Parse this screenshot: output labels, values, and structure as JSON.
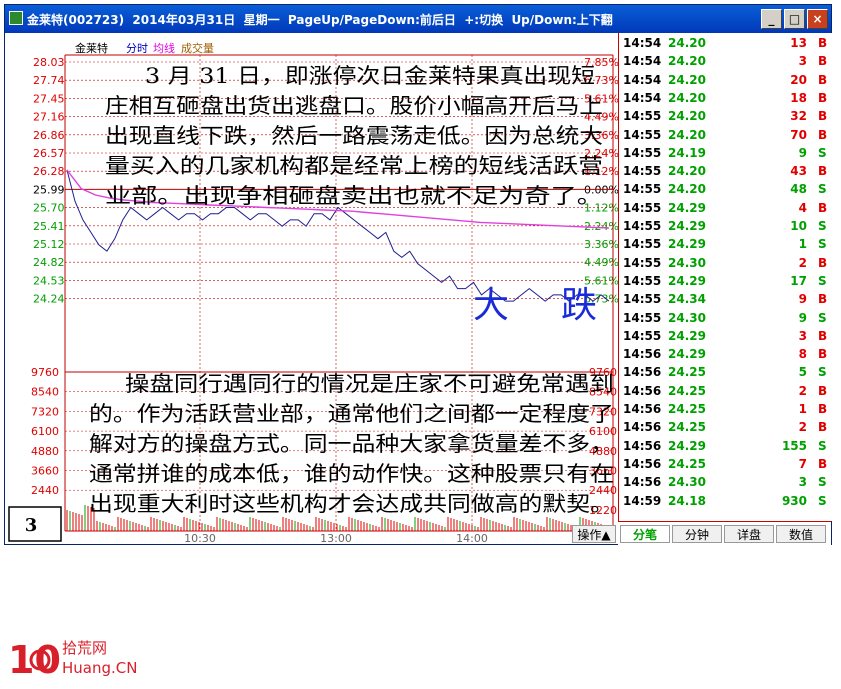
{
  "window": {
    "title": "金莱特(002723)  2014年03月31日  星期一  PageUp/PageDown:前后日  +:切换  Up/Down:上下翻",
    "minimize": "_",
    "maximize": "□",
    "close": "×"
  },
  "chart": {
    "stock_name": "金莱特",
    "tab_intraday": "分时",
    "tab_avg": "均线",
    "tab_volume": "成交量",
    "price_ticks": [
      "28.03",
      "27.74",
      "27.45",
      "27.16",
      "26.86",
      "26.57",
      "26.28",
      "25.99",
      "25.70",
      "25.41",
      "25.12",
      "24.82",
      "24.53",
      "24.24"
    ],
    "pct_ticks": [
      "7.85%",
      "6.73%",
      "5.61%",
      "4.49%",
      "3.36%",
      "2.24%",
      "1.12%",
      "0.00%",
      "1.12%",
      "2.24%",
      "3.36%",
      "4.49%",
      "5.61%",
      "6.73%"
    ],
    "vol_ticks_left": [
      "9760",
      "8540",
      "7320",
      "6100",
      "4880",
      "3660",
      "2440"
    ],
    "vol_ticks_right": [
      "9760",
      "8540",
      "7320",
      "6100",
      "4880",
      "3660",
      "2440",
      "1220"
    ],
    "time_labels": [
      "10:30",
      "13:00",
      "14:00"
    ],
    "page_number": "3",
    "op_button": "操作▲",
    "annotation_top": "3 月 31 日，即涨停次日金莱特果真出现短庄相互砸盘出货出逃盘口。股价小幅高开后马上出现直线下跌，然后一路震荡走低。因为总统大量买入的几家机构都是经常上榜的短线活跃营业部。出现争相砸盘卖出也就不足为奇了。",
    "annotation_top_lines": [
      "3 月 31 日，即涨停次日金莱特果真出现短",
      "庄相互砸盘出货出逃盘口。股价小幅高开后马上",
      "出现直线下跌，然后一路震荡走低。因为总统大",
      "量买入的几家机构都是经常上榜的短线活跃营",
      "业部。出现争相砸盘卖出也就不足为奇了。"
    ],
    "big_label_1": "大",
    "big_label_2": "跌",
    "annotation_bottom_lines": [
      "操盘同行遇同行的情况是庄家不可避免常遇到",
      "的。作为活跃营业部，通常他们之间都一定程度了",
      "解对方的操盘方式。同一品种大家拿货量差不多，",
      "通常拼谁的成本低，谁的动作快。这种股票只有在",
      "出现重大利时这些机构才会达成共同做高的默契。"
    ],
    "colors": {
      "price_line": "#1f1f8f",
      "avg_line": "#e040e0",
      "up": "#e00000",
      "down": "#00a000",
      "grid": "#c00000"
    }
  },
  "chart_data": {
    "type": "line",
    "title": "金莱特(002723) 2014年03月31日",
    "reference_price": 25.99,
    "ylim": [
      24.24,
      28.03
    ],
    "series": [
      {
        "name": "分时",
        "values": [
          26.3,
          25.8,
          25.5,
          25.3,
          25.1,
          25.0,
          25.2,
          25.5,
          25.7,
          25.6,
          25.5,
          25.6,
          25.7,
          25.6,
          25.5,
          25.6,
          25.6,
          25.5,
          25.6,
          25.6,
          25.7,
          25.7,
          25.6,
          25.5,
          25.6,
          25.6,
          25.5,
          25.4,
          25.5,
          25.5,
          25.4,
          25.6,
          25.6,
          25.5,
          25.7,
          25.6,
          25.5,
          25.4,
          25.3,
          25.2,
          25.3,
          25.0,
          24.9,
          25.0,
          24.8,
          24.7,
          24.6,
          24.5,
          24.6,
          24.4,
          24.4,
          24.5,
          24.3,
          24.4,
          24.3,
          24.2,
          24.2,
          24.3,
          24.4,
          24.3,
          24.2,
          24.3,
          24.3,
          24.2,
          24.3,
          24.3,
          24.2,
          24.3,
          24.2
        ]
      },
      {
        "name": "均线",
        "values": [
          26.3,
          26.0,
          25.9,
          25.85,
          25.82,
          25.8,
          25.78,
          25.77,
          25.76,
          25.75,
          25.74,
          25.73,
          25.72,
          25.71,
          25.7,
          25.69,
          25.68,
          25.67,
          25.66,
          25.65,
          25.64,
          25.62,
          25.6,
          25.58,
          25.56,
          25.54,
          25.52,
          25.5,
          25.48,
          25.46,
          25.45,
          25.44,
          25.43,
          25.42,
          25.41,
          25.4,
          25.39,
          25.38,
          25.37
        ]
      }
    ]
  },
  "tape": {
    "rows": [
      {
        "time": "14:54",
        "price": "24.20",
        "vol": "13",
        "side": "B"
      },
      {
        "time": "14:54",
        "price": "24.20",
        "vol": "3",
        "side": "B"
      },
      {
        "time": "14:54",
        "price": "24.20",
        "vol": "20",
        "side": "B"
      },
      {
        "time": "14:54",
        "price": "24.20",
        "vol": "18",
        "side": "B"
      },
      {
        "time": "14:55",
        "price": "24.20",
        "vol": "32",
        "side": "B"
      },
      {
        "time": "14:55",
        "price": "24.20",
        "vol": "70",
        "side": "B"
      },
      {
        "time": "14:55",
        "price": "24.19",
        "vol": "9",
        "side": "S"
      },
      {
        "time": "14:55",
        "price": "24.20",
        "vol": "43",
        "side": "B"
      },
      {
        "time": "14:55",
        "price": "24.20",
        "vol": "48",
        "side": "S"
      },
      {
        "time": "14:55",
        "price": "24.29",
        "vol": "4",
        "side": "B"
      },
      {
        "time": "14:55",
        "price": "24.29",
        "vol": "10",
        "side": "S"
      },
      {
        "time": "14:55",
        "price": "24.29",
        "vol": "1",
        "side": "S"
      },
      {
        "time": "14:55",
        "price": "24.30",
        "vol": "2",
        "side": "B"
      },
      {
        "time": "14:55",
        "price": "24.29",
        "vol": "17",
        "side": "S"
      },
      {
        "time": "14:55",
        "price": "24.34",
        "vol": "9",
        "side": "B"
      },
      {
        "time": "14:55",
        "price": "24.30",
        "vol": "9",
        "side": "S"
      },
      {
        "time": "14:55",
        "price": "24.29",
        "vol": "3",
        "side": "B"
      },
      {
        "time": "14:56",
        "price": "24.29",
        "vol": "8",
        "side": "B"
      },
      {
        "time": "14:56",
        "price": "24.25",
        "vol": "5",
        "side": "S"
      },
      {
        "time": "14:56",
        "price": "24.25",
        "vol": "2",
        "side": "B"
      },
      {
        "time": "14:56",
        "price": "24.25",
        "vol": "1",
        "side": "B"
      },
      {
        "time": "14:56",
        "price": "24.25",
        "vol": "2",
        "side": "B"
      },
      {
        "time": "14:56",
        "price": "24.29",
        "vol": "155",
        "side": "S"
      },
      {
        "time": "14:56",
        "price": "24.25",
        "vol": "7",
        "side": "B"
      },
      {
        "time": "14:56",
        "price": "24.30",
        "vol": "3",
        "side": "S"
      },
      {
        "time": "14:59",
        "price": "24.18",
        "vol": "930",
        "side": "S"
      }
    ],
    "tabs": [
      "分笔",
      "分钟",
      "详盘",
      "数值"
    ]
  },
  "watermark": {
    "brand": "拾荒网",
    "domain": "Huang.CN",
    "mark": "10"
  }
}
